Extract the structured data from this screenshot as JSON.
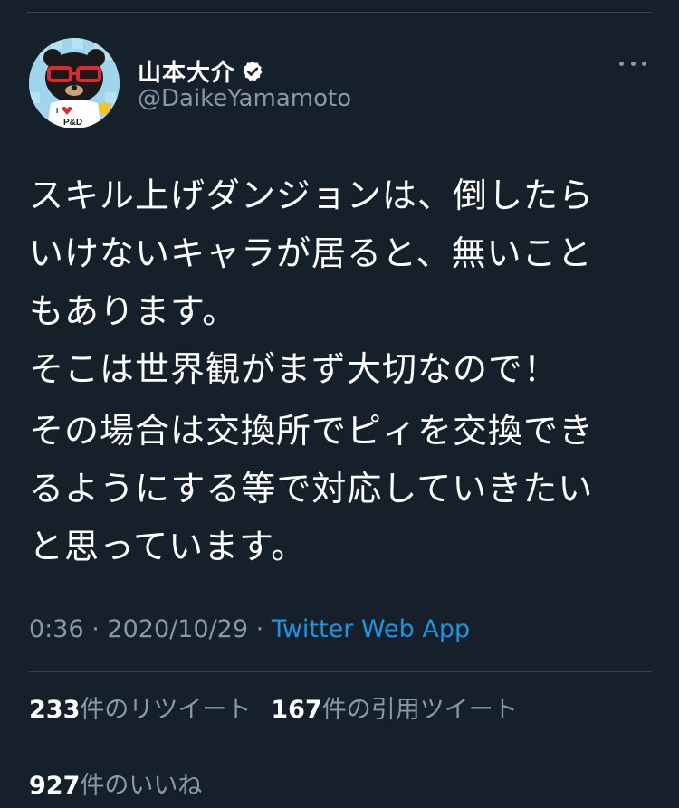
{
  "user": {
    "display_name": "山本大介",
    "handle": "@DaikeYamamoto",
    "verified_icon": "verified-badge-icon"
  },
  "tweet": {
    "lines": [
      "スキル上げダンジョンは、倒したら",
      "いけないキャラが居ると、無いこと",
      "もあります。",
      "そこは世界観がまず大切なので！",
      "その場合は交換所でピィを交換でき",
      "るようにする等で対応していきたい",
      "と思っています。"
    ],
    "time": "0:36",
    "date": "2020/10/29",
    "separator": "·",
    "source": "Twitter Web App"
  },
  "stats": {
    "retweets_count": "233",
    "retweets_label": "件のリツイート",
    "quotes_count": "167",
    "quotes_label": "件の引用ツイート",
    "likes_count": "927",
    "likes_label": "件のいいね"
  },
  "avatar_text": {
    "line1": "I",
    "line2": "P&D"
  },
  "colors": {
    "background": "#15202b",
    "text": "#ffffff",
    "secondary": "#8899a6",
    "link": "#1b95e0",
    "divider": "#38444d"
  }
}
